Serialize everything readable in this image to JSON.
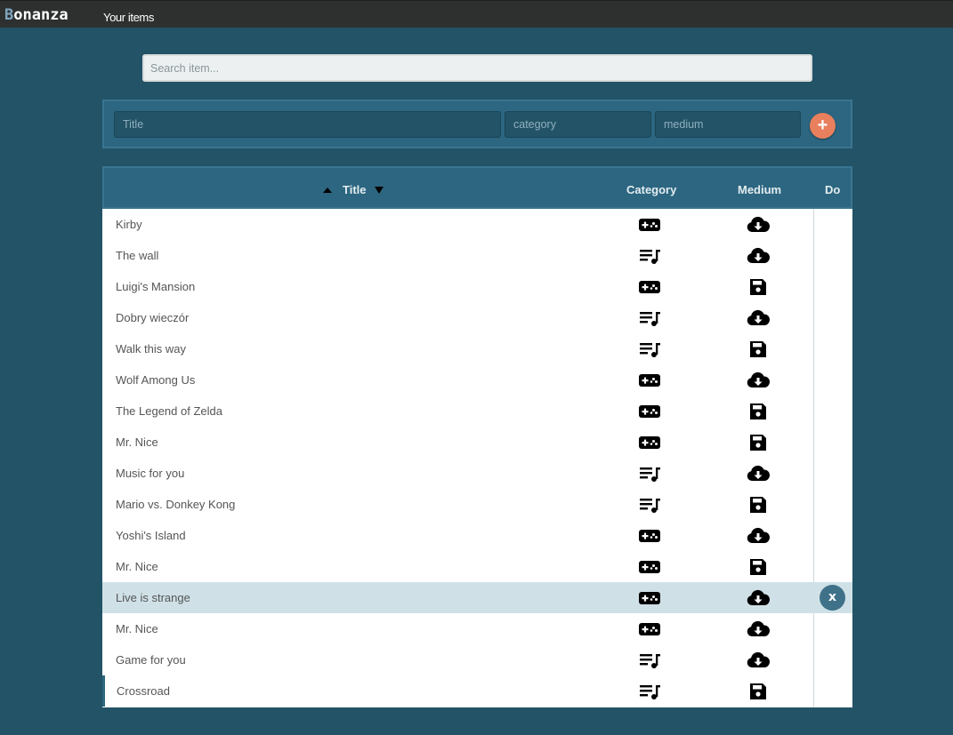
{
  "app": {
    "logo": "Bonanza",
    "logo_first": "B",
    "logo_rest": "onanza",
    "nav_link": "Your items"
  },
  "search": {
    "placeholder": "Search item..."
  },
  "add_form": {
    "title_placeholder": "Title",
    "category_placeholder": "category",
    "medium_placeholder": "medium",
    "add_label": "+"
  },
  "table": {
    "headers": {
      "title": "Title",
      "category": "Category",
      "medium": "Medium",
      "do": "Do"
    },
    "delete_label": "x",
    "rows": [
      {
        "title": "Kirby",
        "category": "game",
        "medium": "cloud-download"
      },
      {
        "title": "The wall",
        "category": "music",
        "medium": "cloud-download"
      },
      {
        "title": "Luigi's Mansion",
        "category": "game",
        "medium": "floppy-disk"
      },
      {
        "title": "Dobry wieczór",
        "category": "music",
        "medium": "cloud-download"
      },
      {
        "title": "Walk this way",
        "category": "music",
        "medium": "floppy-disk"
      },
      {
        "title": "Wolf Among Us",
        "category": "game",
        "medium": "cloud-download"
      },
      {
        "title": "The Legend of Zelda",
        "category": "game",
        "medium": "floppy-disk"
      },
      {
        "title": "Mr. Nice",
        "category": "game",
        "medium": "floppy-disk"
      },
      {
        "title": "Music for you",
        "category": "music",
        "medium": "cloud-download"
      },
      {
        "title": "Mario vs. Donkey Kong",
        "category": "music",
        "medium": "floppy-disk"
      },
      {
        "title": "Yoshi's Island",
        "category": "game",
        "medium": "cloud-download"
      },
      {
        "title": "Mr. Nice",
        "category": "game",
        "medium": "floppy-disk"
      },
      {
        "title": "Live is strange",
        "category": "game",
        "medium": "cloud-download",
        "hovered": true
      },
      {
        "title": "Mr. Nice",
        "category": "game",
        "medium": "cloud-download"
      },
      {
        "title": "Game for you",
        "category": "music",
        "medium": "cloud-download"
      },
      {
        "title": "Crossroad",
        "category": "music",
        "medium": "floppy-disk",
        "active": true
      }
    ]
  },
  "colors": {
    "background": "#235366",
    "topbar": "#2e3030",
    "panel": "#2d6680",
    "accent": "#e8805e",
    "hover_row": "#cfe1e7"
  }
}
